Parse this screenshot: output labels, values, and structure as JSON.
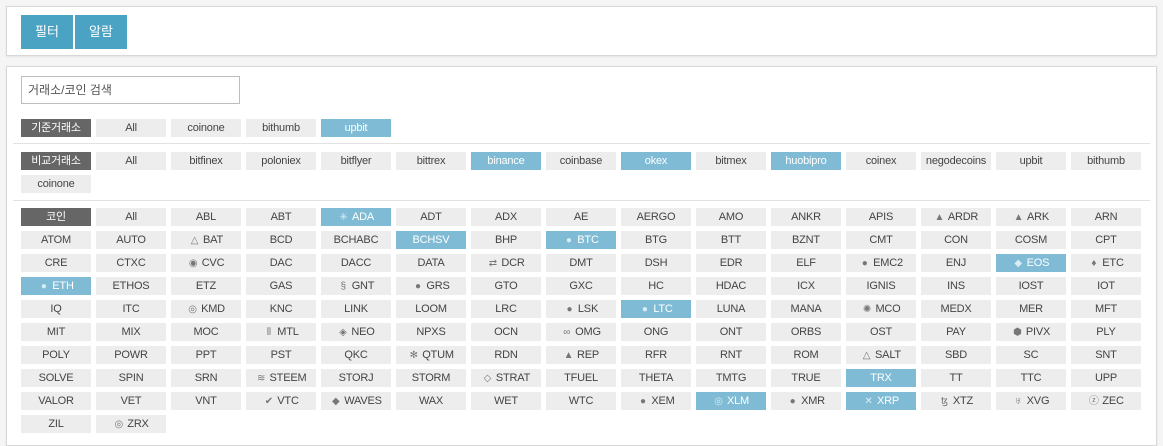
{
  "top": {
    "filter_label": "필터",
    "alarm_label": "알람"
  },
  "search": {
    "placeholder": "거래소/코인 검색"
  },
  "base_exchange": {
    "label": "기준거래소",
    "items": [
      {
        "label": "All",
        "selected": false
      },
      {
        "label": "coinone",
        "selected": false
      },
      {
        "label": "bithumb",
        "selected": false
      },
      {
        "label": "upbit",
        "selected": true
      }
    ]
  },
  "compare_exchange": {
    "label": "비교거래소",
    "items": [
      {
        "label": "All",
        "selected": false
      },
      {
        "label": "bitfinex",
        "selected": false
      },
      {
        "label": "poloniex",
        "selected": false
      },
      {
        "label": "bitflyer",
        "selected": false
      },
      {
        "label": "bittrex",
        "selected": false
      },
      {
        "label": "binance",
        "selected": true
      },
      {
        "label": "coinbase",
        "selected": false
      },
      {
        "label": "okex",
        "selected": true
      },
      {
        "label": "bitmex",
        "selected": false
      },
      {
        "label": "huobipro",
        "selected": true
      },
      {
        "label": "coinex",
        "selected": false
      },
      {
        "label": "negodecoins",
        "selected": false
      },
      {
        "label": "upbit",
        "selected": false
      },
      {
        "label": "bithumb",
        "selected": false
      },
      {
        "label": "coinone",
        "selected": false
      }
    ]
  },
  "coins": {
    "label": "코인",
    "items": [
      {
        "label": "All"
      },
      {
        "label": "ABL"
      },
      {
        "label": "ABT"
      },
      {
        "label": "ADA",
        "selected": true,
        "icon": "ada-icon",
        "glyph": "✳"
      },
      {
        "label": "ADT"
      },
      {
        "label": "ADX"
      },
      {
        "label": "AE"
      },
      {
        "label": "AERGO"
      },
      {
        "label": "AMO"
      },
      {
        "label": "ANKR"
      },
      {
        "label": "APIS"
      },
      {
        "label": "ARDR",
        "icon": "ardr-icon",
        "glyph": "▲"
      },
      {
        "label": "ARK",
        "icon": "ark-icon",
        "glyph": "▲"
      },
      {
        "label": "ARN"
      },
      {
        "label": "ATOM"
      },
      {
        "label": "AUTO"
      },
      {
        "label": "BAT",
        "icon": "bat-icon",
        "glyph": "△"
      },
      {
        "label": "BCD"
      },
      {
        "label": "BCHABC"
      },
      {
        "label": "BCHSV",
        "selected": true
      },
      {
        "label": "BHP"
      },
      {
        "label": "BTC",
        "selected": true,
        "icon": "btc-icon",
        "glyph": "●"
      },
      {
        "label": "BTG"
      },
      {
        "label": "BTT"
      },
      {
        "label": "BZNT"
      },
      {
        "label": "CMT"
      },
      {
        "label": "CON"
      },
      {
        "label": "COSM"
      },
      {
        "label": "CPT"
      },
      {
        "label": "CRE"
      },
      {
        "label": "CTXC"
      },
      {
        "label": "CVC",
        "icon": "cvc-icon",
        "glyph": "◉"
      },
      {
        "label": "DAC"
      },
      {
        "label": "DACC"
      },
      {
        "label": "DATA"
      },
      {
        "label": "DCR",
        "icon": "dcr-icon",
        "glyph": "⇄"
      },
      {
        "label": "DMT"
      },
      {
        "label": "DSH"
      },
      {
        "label": "EDR"
      },
      {
        "label": "ELF"
      },
      {
        "label": "EMC2",
        "icon": "emc2-icon",
        "glyph": "●"
      },
      {
        "label": "ENJ"
      },
      {
        "label": "EOS",
        "selected": true,
        "icon": "eos-icon",
        "glyph": "◆"
      },
      {
        "label": "ETC",
        "icon": "etc-icon",
        "glyph": "♦"
      },
      {
        "label": "ETH",
        "selected": true,
        "icon": "eth-icon",
        "glyph": "●"
      },
      {
        "label": "ETHOS"
      },
      {
        "label": "ETZ"
      },
      {
        "label": "GAS"
      },
      {
        "label": "GNT",
        "icon": "gnt-icon",
        "glyph": "§"
      },
      {
        "label": "GRS",
        "icon": "grs-icon",
        "glyph": "●"
      },
      {
        "label": "GTO"
      },
      {
        "label": "GXC"
      },
      {
        "label": "HC"
      },
      {
        "label": "HDAC"
      },
      {
        "label": "ICX"
      },
      {
        "label": "IGNIS"
      },
      {
        "label": "INS"
      },
      {
        "label": "IOST"
      },
      {
        "label": "IOT"
      },
      {
        "label": "IQ"
      },
      {
        "label": "ITC"
      },
      {
        "label": "KMD",
        "icon": "kmd-icon",
        "glyph": "◎"
      },
      {
        "label": "KNC"
      },
      {
        "label": "LINK"
      },
      {
        "label": "LOOM"
      },
      {
        "label": "LRC"
      },
      {
        "label": "LSK",
        "icon": "lsk-icon",
        "glyph": "●"
      },
      {
        "label": "LTC",
        "selected": true,
        "icon": "ltc-icon",
        "glyph": "●"
      },
      {
        "label": "LUNA"
      },
      {
        "label": "MANA"
      },
      {
        "label": "MCO",
        "icon": "mco-icon",
        "glyph": "✺"
      },
      {
        "label": "MEDX"
      },
      {
        "label": "MER"
      },
      {
        "label": "MFT"
      },
      {
        "label": "MIT"
      },
      {
        "label": "MIX"
      },
      {
        "label": "MOC"
      },
      {
        "label": "MTL",
        "icon": "mtl-icon",
        "glyph": "⦀"
      },
      {
        "label": "NEO",
        "icon": "neo-icon",
        "glyph": "◈"
      },
      {
        "label": "NPXS"
      },
      {
        "label": "OCN"
      },
      {
        "label": "OMG",
        "icon": "omg-icon",
        "glyph": "∞"
      },
      {
        "label": "ONG"
      },
      {
        "label": "ONT"
      },
      {
        "label": "ORBS"
      },
      {
        "label": "OST"
      },
      {
        "label": "PAY"
      },
      {
        "label": "PIVX",
        "icon": "pivx-icon",
        "glyph": "⬢"
      },
      {
        "label": "PLY"
      },
      {
        "label": "POLY"
      },
      {
        "label": "POWR"
      },
      {
        "label": "PPT"
      },
      {
        "label": "PST"
      },
      {
        "label": "QKC"
      },
      {
        "label": "QTUM",
        "icon": "qtum-icon",
        "glyph": "✻"
      },
      {
        "label": "RDN"
      },
      {
        "label": "REP",
        "icon": "rep-icon",
        "glyph": "▲"
      },
      {
        "label": "RFR"
      },
      {
        "label": "RNT"
      },
      {
        "label": "ROM"
      },
      {
        "label": "SALT",
        "icon": "salt-icon",
        "glyph": "△"
      },
      {
        "label": "SBD"
      },
      {
        "label": "SC"
      },
      {
        "label": "SNT"
      },
      {
        "label": "SOLVE"
      },
      {
        "label": "SPIN"
      },
      {
        "label": "SRN"
      },
      {
        "label": "STEEM",
        "icon": "steem-icon",
        "glyph": "≋"
      },
      {
        "label": "STORJ"
      },
      {
        "label": "STORM"
      },
      {
        "label": "STRAT",
        "icon": "strat-icon",
        "glyph": "◇"
      },
      {
        "label": "TFUEL"
      },
      {
        "label": "THETA"
      },
      {
        "label": "TMTG"
      },
      {
        "label": "TRUE"
      },
      {
        "label": "TRX",
        "selected": true
      },
      {
        "label": "TT"
      },
      {
        "label": "TTC"
      },
      {
        "label": "UPP"
      },
      {
        "label": "VALOR"
      },
      {
        "label": "VET"
      },
      {
        "label": "VNT"
      },
      {
        "label": "VTC",
        "icon": "vtc-icon",
        "glyph": "✔"
      },
      {
        "label": "WAVES",
        "icon": "waves-icon",
        "glyph": "◆"
      },
      {
        "label": "WAX"
      },
      {
        "label": "WET"
      },
      {
        "label": "WTC"
      },
      {
        "label": "XEM",
        "icon": "xem-icon",
        "glyph": "●"
      },
      {
        "label": "XLM",
        "selected": true,
        "icon": "xlm-icon",
        "glyph": "◎"
      },
      {
        "label": "XMR",
        "icon": "xmr-icon",
        "glyph": "●"
      },
      {
        "label": "XRP",
        "selected": true,
        "icon": "xrp-icon",
        "glyph": "✕"
      },
      {
        "label": "XTZ",
        "icon": "xtz-icon",
        "glyph": "ꜩ"
      },
      {
        "label": "XVG",
        "icon": "xvg-icon",
        "glyph": "♅"
      },
      {
        "label": "ZEC",
        "icon": "zec-icon",
        "glyph": "ⓩ"
      },
      {
        "label": "ZIL"
      },
      {
        "label": "ZRX",
        "icon": "zrx-icon",
        "glyph": "◎"
      }
    ]
  },
  "colors": {
    "accent": "#4ba3c3",
    "selected": "#7fbbd4",
    "label_bg": "#666666",
    "chip_bg": "#ededed"
  }
}
